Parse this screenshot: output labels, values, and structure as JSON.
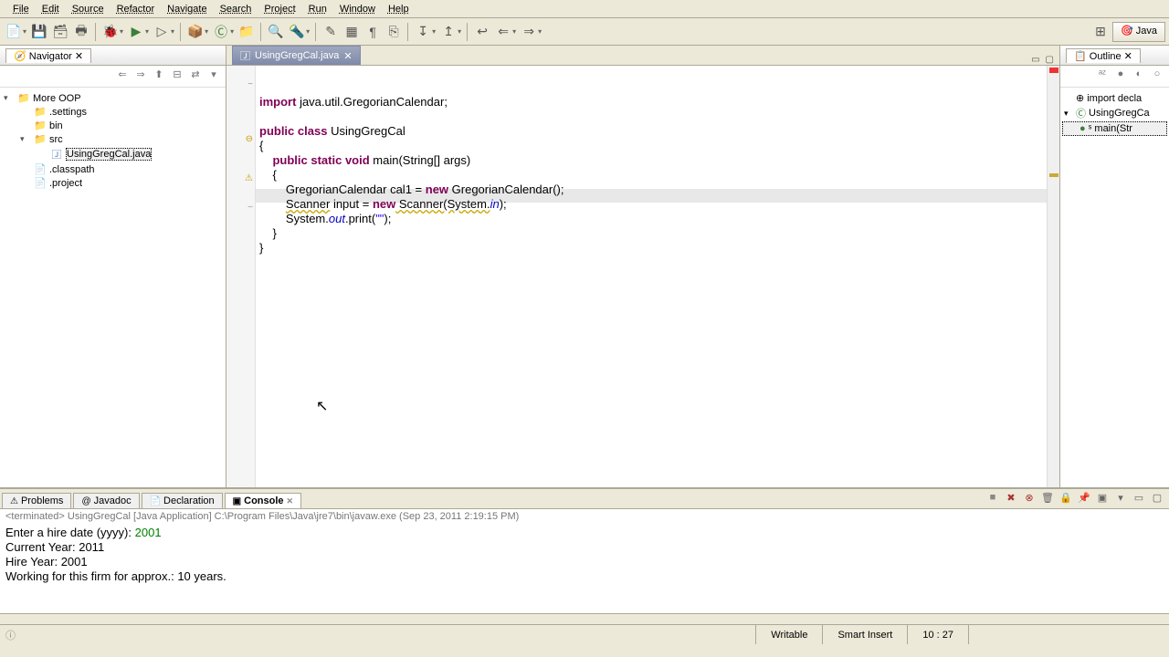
{
  "menu": {
    "file": "File",
    "edit": "Edit",
    "source": "Source",
    "refactor": "Refactor",
    "navigate": "Navigate",
    "search": "Search",
    "project": "Project",
    "run": "Run",
    "window": "Window",
    "help": "Help"
  },
  "navigator": {
    "title": "Navigator",
    "project": "More OOP",
    "folders": {
      "settings": ".settings",
      "bin": "bin",
      "src": "src"
    },
    "files": {
      "javafile": "UsingGregCal.java",
      "classpath": ".classpath",
      "project": ".project"
    }
  },
  "editor": {
    "tab": "UsingGregCal.java",
    "code": {
      "import": "import",
      "import_target": " java.util.GregorianCalendar;",
      "public": "public",
      "class": "class",
      "classname": " UsingGregCal",
      "brace_open": "{",
      "static": "static",
      "void": "void",
      "main_sig": " main(String[] args)",
      "gc_decl": "GregorianCalendar cal1 = ",
      "new": "new",
      "gc_ctor": " GregorianCalendar();",
      "scanner_decl": "Scanner",
      "scanner_var": " input = ",
      "scanner_ctor": " Scanner(System.",
      "in": "in",
      "scanner_end": ");",
      "sysout1": "System.",
      "out": "out",
      "sysout2": ".print(",
      "str": "\"\"",
      "sysout3": ");",
      "brace_close": "}"
    }
  },
  "outline": {
    "title": "Outline",
    "items": {
      "import_decl": "import decla",
      "class": "UsingGregCa",
      "main": "main(Str"
    }
  },
  "bottom": {
    "tabs": {
      "problems": "Problems",
      "javadoc": "Javadoc",
      "declaration": "Declaration",
      "console": "Console"
    },
    "console_desc": "<terminated> UsingGregCal [Java Application] C:\\Program Files\\Java\\jre7\\bin\\javaw.exe (Sep 23, 2011 2:19:15 PM)",
    "output": {
      "l1a": "Enter a hire date (yyyy): ",
      "l1b": "2001",
      "l2": "Current Year: 2011",
      "l3": "Hire Year: 2001",
      "l4": "Working for this firm for approx.: 10 years."
    }
  },
  "status": {
    "writable": "Writable",
    "insert": "Smart Insert",
    "pos": "10 : 27"
  }
}
